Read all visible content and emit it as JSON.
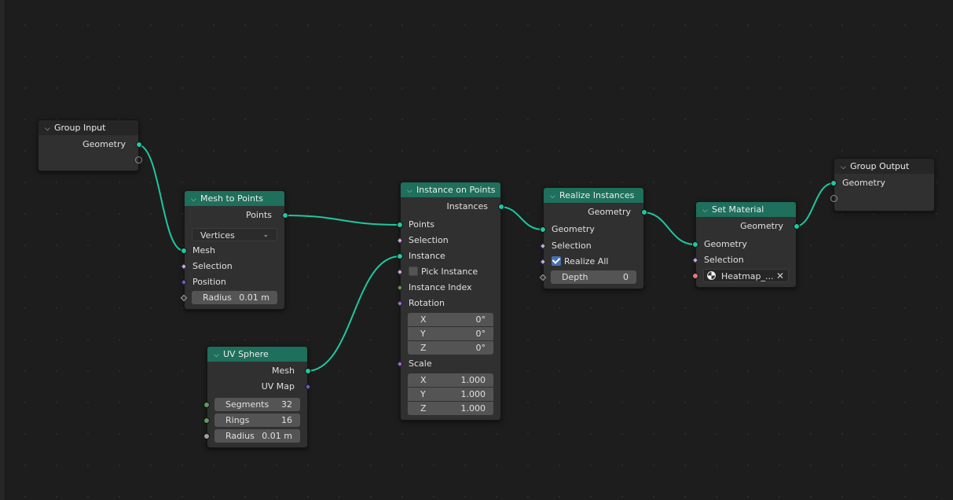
{
  "nodes": {
    "group_input": {
      "title": "Group Input",
      "out_geometry": "Geometry"
    },
    "mesh_to_points": {
      "title": "Mesh to Points",
      "out_points": "Points",
      "mode": "Vertices",
      "in_mesh": "Mesh",
      "in_selection": "Selection",
      "in_position": "Position",
      "radius_label": "Radius",
      "radius_value": "0.01 m"
    },
    "uv_sphere": {
      "title": "UV Sphere",
      "out_mesh": "Mesh",
      "out_uvmap": "UV Map",
      "segments_label": "Segments",
      "segments_value": "32",
      "rings_label": "Rings",
      "rings_value": "16",
      "radius_label": "Radius",
      "radius_value": "0.01 m"
    },
    "instance_on_points": {
      "title": "Instance on Points",
      "out_instances": "Instances",
      "in_points": "Points",
      "in_selection": "Selection",
      "in_instance": "Instance",
      "pick_instance": "Pick Instance",
      "in_instance_index": "Instance Index",
      "in_rotation": "Rotation",
      "rotation": [
        {
          "axis": "X",
          "value": "0°"
        },
        {
          "axis": "Y",
          "value": "0°"
        },
        {
          "axis": "Z",
          "value": "0°"
        }
      ],
      "in_scale": "Scale",
      "scale": [
        {
          "axis": "X",
          "value": "1.000"
        },
        {
          "axis": "Y",
          "value": "1.000"
        },
        {
          "axis": "Z",
          "value": "1.000"
        }
      ]
    },
    "realize_instances": {
      "title": "Realize Instances",
      "out_geometry": "Geometry",
      "in_geometry": "Geometry",
      "in_selection": "Selection",
      "realize_all": "Realize All",
      "depth_label": "Depth",
      "depth_value": "0"
    },
    "set_material": {
      "title": "Set Material",
      "out_geometry": "Geometry",
      "in_geometry": "Geometry",
      "in_selection": "Selection",
      "material": "Heatmap_..."
    },
    "group_output": {
      "title": "Group Output",
      "in_geometry": "Geometry"
    }
  },
  "colors": {
    "header": "#1e6f5b",
    "geometry_socket": "#1fc7a0",
    "link": "#1fc7a0",
    "background": "#1d1d1d"
  }
}
